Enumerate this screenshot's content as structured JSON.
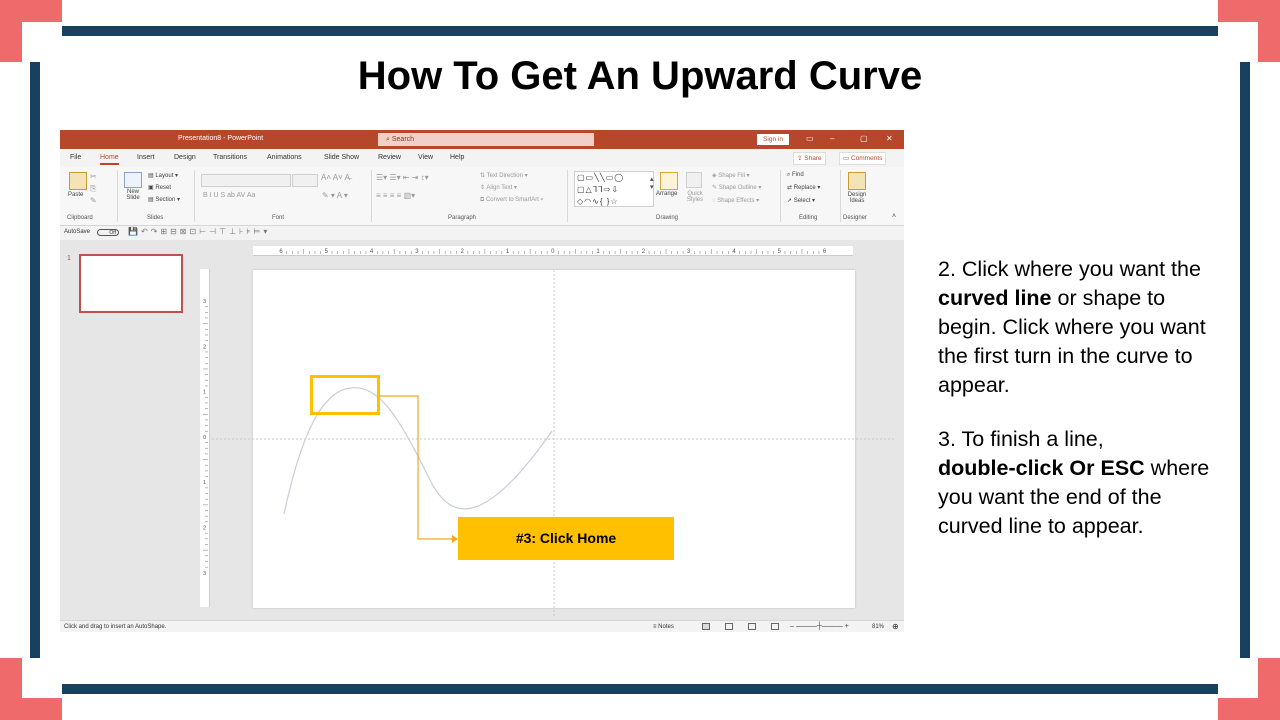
{
  "slide": {
    "title": "How To Get An Upward Curve",
    "callout_label": "#3: Click Home",
    "instructions": [
      {
        "prefix": "2.  Click where you want the ",
        "bold": "curved line",
        "suffix": " or shape to begin. Click where you want the first turn in the curve to appear."
      },
      {
        "prefix": "3.  To finish a line, ",
        "bold": "double-click Or ESC",
        "suffix": " where you want the end of the curved line to appear."
      }
    ]
  },
  "colors": {
    "frame": "#17415f",
    "corner": "#ef6b6b",
    "accent": "#ffc000",
    "ppt_brand": "#b7472a"
  },
  "ppt": {
    "window_title": "Presentation8  -  PowerPoint",
    "search_placeholder": "Search",
    "sign_in": "Sign in",
    "tabs": [
      "File",
      "Home",
      "Insert",
      "Design",
      "Transitions",
      "Animations",
      "Slide Show",
      "Review",
      "View",
      "Help"
    ],
    "active_tab": "Home",
    "share": "Share",
    "comments": "Comments",
    "ribbon": {
      "clipboard": {
        "label": "Clipboard",
        "paste": "Paste"
      },
      "slides": {
        "label": "Slides",
        "new_slide": "New Slide",
        "layout": "Layout",
        "reset": "Reset",
        "section": "Section"
      },
      "font": {
        "label": "Font",
        "format_buttons": "B  I  U  S  ab  AV  Aa"
      },
      "paragraph": {
        "label": "Paragraph",
        "text_direction": "Text Direction",
        "align_text": "Align Text",
        "convert_smartart": "Convert to SmartArt"
      },
      "drawing": {
        "label": "Drawing",
        "arrange": "Arrange",
        "quick_styles": "Quick Styles",
        "shape_fill": "Shape Fill",
        "shape_outline": "Shape Outline",
        "shape_effects": "Shape Effects"
      },
      "editing": {
        "label": "Editing",
        "find": "Find",
        "replace": "Replace",
        "select": "Select"
      },
      "designer": {
        "label": "Designer",
        "design_ideas": "Design Ideas"
      }
    },
    "qat": {
      "autosave": "AutoSave",
      "toggle": "Off"
    },
    "slide_number": "1",
    "hruler_labels": [
      "6",
      "5",
      "4",
      "3",
      "2",
      "1",
      "0",
      "1",
      "2",
      "3",
      "4",
      "5",
      "6"
    ],
    "vruler_labels": [
      "3",
      "2",
      "1",
      "0",
      "1",
      "2",
      "3"
    ],
    "status": {
      "hint": "Click and drag to insert an AutoShape.",
      "notes": "Notes",
      "zoom": "81%"
    }
  }
}
